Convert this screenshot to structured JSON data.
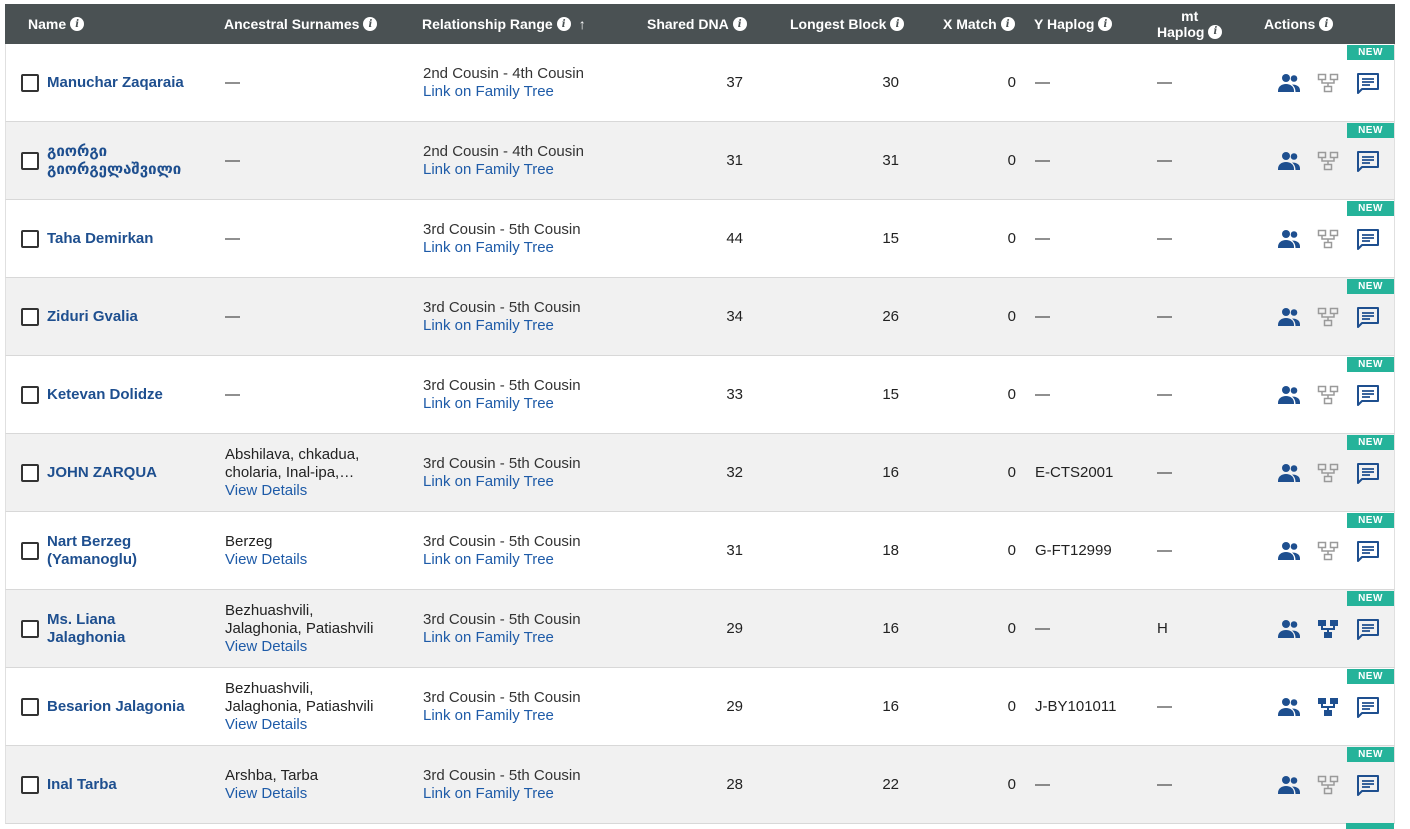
{
  "header": {
    "name": "Name",
    "ancestral_surnames": "Ancestral Surnames",
    "relationship_range": "Relationship Range",
    "shared_dna": "Shared DNA",
    "longest_block": "Longest Block",
    "x_match": "X Match",
    "y_haplog": "Y Haplog",
    "mt_haplog_line1": "mt",
    "mt_haplog_line2": "Haplog",
    "actions": "Actions",
    "info_glyph": "i",
    "sort_glyph": "↑"
  },
  "badge_label": "NEW",
  "link_label": "Link on Family Tree",
  "view_details_label": "View Details",
  "colors": {
    "header_bg": "#4a5153",
    "name_link": "#1e4f8f",
    "link": "#1e5ba8",
    "badge": "#25b39a",
    "icon_active": "#1e4f8f",
    "icon_inactive": "#9a9a9a",
    "row_alt": "#f1f1f1"
  },
  "rows": [
    {
      "name_1": "Manuchar Zaqaraia",
      "name_2": "",
      "surname_1": "—",
      "surname_2": "",
      "details": "",
      "relationship": "2nd Cousin - 4th Cousin",
      "shared_dna": "37",
      "longest_block": "30",
      "x_match": "0",
      "y_haplog": "—",
      "mt_haplog": "—",
      "tree_active": false
    },
    {
      "name_1": "გიორგი",
      "name_2": "გიორგელაშვილი",
      "surname_1": "—",
      "surname_2": "",
      "details": "",
      "relationship": "2nd Cousin - 4th Cousin",
      "shared_dna": "31",
      "longest_block": "31",
      "x_match": "0",
      "y_haplog": "—",
      "mt_haplog": "—",
      "tree_active": false
    },
    {
      "name_1": "Taha Demirkan",
      "name_2": "",
      "surname_1": "—",
      "surname_2": "",
      "details": "",
      "relationship": "3rd Cousin - 5th Cousin",
      "shared_dna": "44",
      "longest_block": "15",
      "x_match": "0",
      "y_haplog": "—",
      "mt_haplog": "—",
      "tree_active": false
    },
    {
      "name_1": "Ziduri Gvalia",
      "name_2": "",
      "surname_1": "—",
      "surname_2": "",
      "details": "",
      "relationship": "3rd Cousin - 5th Cousin",
      "shared_dna": "34",
      "longest_block": "26",
      "x_match": "0",
      "y_haplog": "—",
      "mt_haplog": "—",
      "tree_active": false
    },
    {
      "name_1": "Ketevan Dolidze",
      "name_2": "",
      "surname_1": "—",
      "surname_2": "",
      "details": "",
      "relationship": "3rd Cousin - 5th Cousin",
      "shared_dna": "33",
      "longest_block": "15",
      "x_match": "0",
      "y_haplog": "—",
      "mt_haplog": "—",
      "tree_active": false
    },
    {
      "name_1": "JOHN ZARQUA",
      "name_2": "",
      "surname_1": "Abshilava, chkadua,",
      "surname_2": "cholaria, Inal-ipa,…",
      "details": "View Details",
      "relationship": "3rd Cousin - 5th Cousin",
      "shared_dna": "32",
      "longest_block": "16",
      "x_match": "0",
      "y_haplog": "E-CTS2001",
      "mt_haplog": "—",
      "tree_active": false
    },
    {
      "name_1": "Nart Berzeg",
      "name_2": "(Yamanoglu)",
      "surname_1": "Berzeg",
      "surname_2": "",
      "details": "View Details",
      "relationship": "3rd Cousin - 5th Cousin",
      "shared_dna": "31",
      "longest_block": "18",
      "x_match": "0",
      "y_haplog": "G-FT12999",
      "mt_haplog": "—",
      "tree_active": false
    },
    {
      "name_1": "Ms. Liana",
      "name_2": "Jalaghonia",
      "surname_1": "Bezhuashvili,",
      "surname_2": "Jalaghonia, Patiashvili",
      "details": "View Details",
      "relationship": "3rd Cousin - 5th Cousin",
      "shared_dna": "29",
      "longest_block": "16",
      "x_match": "0",
      "y_haplog": "—",
      "mt_haplog": "H",
      "tree_active": true
    },
    {
      "name_1": "Besarion Jalagonia",
      "name_2": "",
      "surname_1": "Bezhuashvili,",
      "surname_2": "Jalaghonia, Patiashvili",
      "details": "View Details",
      "relationship": "3rd Cousin - 5th Cousin",
      "shared_dna": "29",
      "longest_block": "16",
      "x_match": "0",
      "y_haplog": "J-BY101011",
      "mt_haplog": "—",
      "tree_active": true
    },
    {
      "name_1": "Inal Tarba",
      "name_2": "",
      "surname_1": "Arshba, Tarba",
      "surname_2": "",
      "details": "View Details",
      "relationship": "3rd Cousin - 5th Cousin",
      "shared_dna": "28",
      "longest_block": "22",
      "x_match": "0",
      "y_haplog": "—",
      "mt_haplog": "—",
      "tree_active": false
    }
  ]
}
